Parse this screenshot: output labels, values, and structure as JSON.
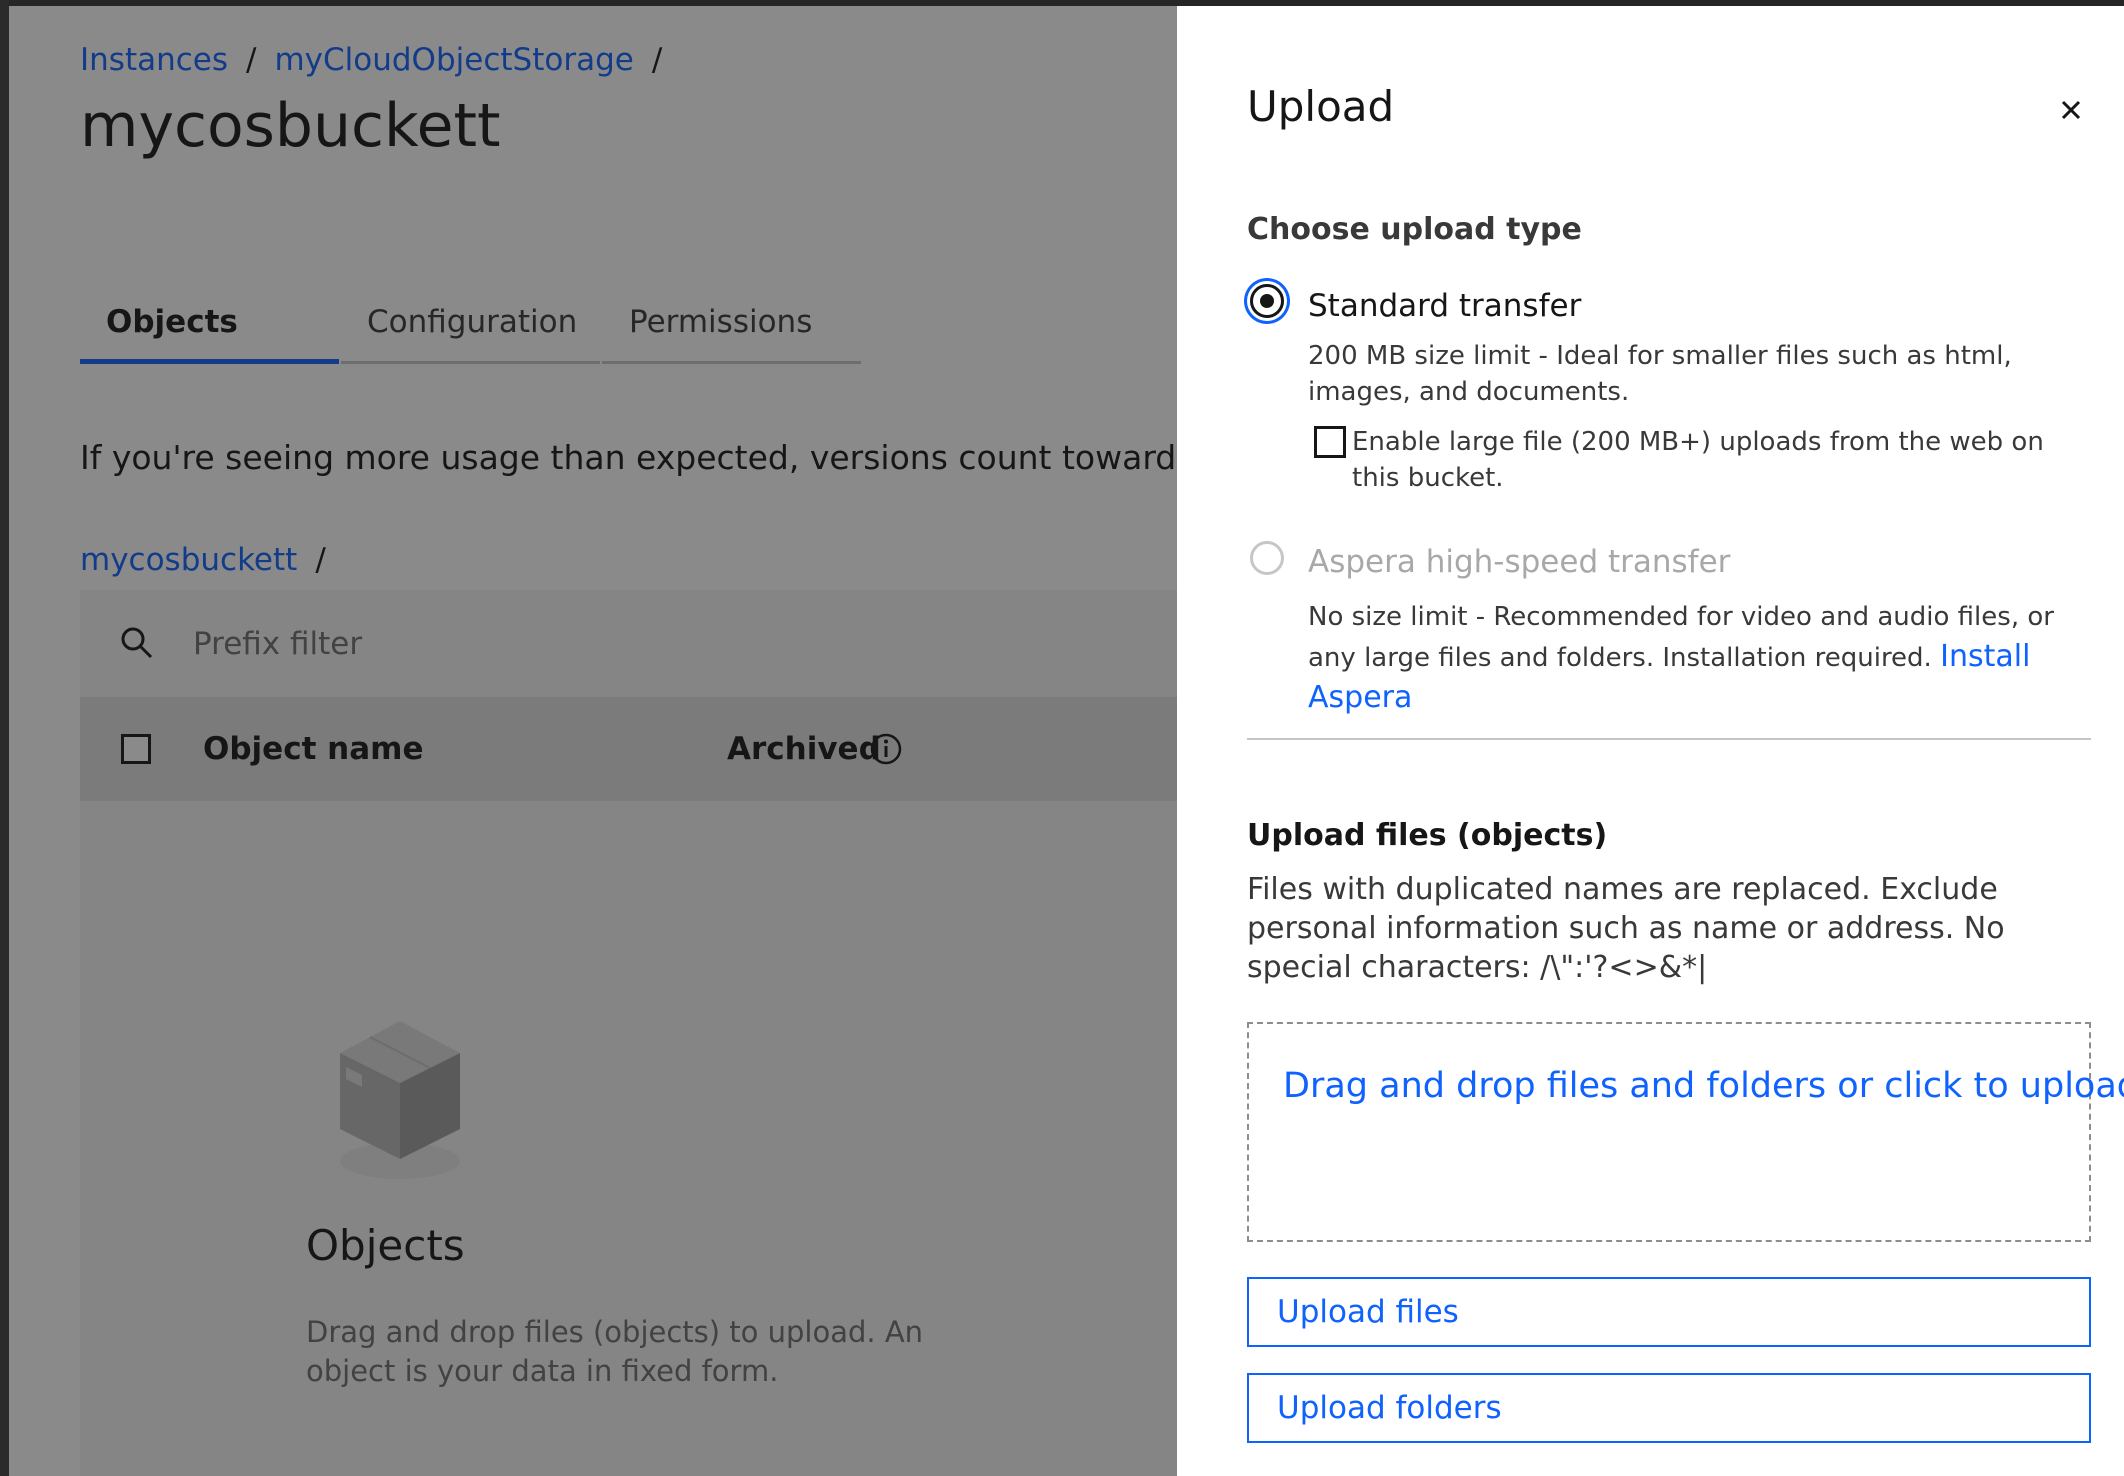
{
  "breadcrumb": {
    "items": [
      "Instances",
      "myCloudObjectStorage"
    ],
    "separator": "/"
  },
  "page_title": "mycosbuckett",
  "tabs": [
    {
      "label": "Objects",
      "active": true
    },
    {
      "label": "Configuration",
      "active": false
    },
    {
      "label": "Permissions",
      "active": false
    }
  ],
  "notice": "If you're seeing more usage than expected, versions count towards yo",
  "sub_breadcrumb": {
    "bucket": "mycosbuckett",
    "separator": "/"
  },
  "search": {
    "placeholder": "Prefix filter",
    "icon": "search-icon"
  },
  "table": {
    "columns": [
      "Object name",
      "Archived"
    ],
    "info_icon": "info-icon"
  },
  "empty_state": {
    "icon": "box-icon",
    "title": "Objects",
    "text": "Drag and drop files (objects) to upload. An object is your data in fixed form."
  },
  "panel": {
    "title": "Upload",
    "close_icon": "close-icon",
    "upload_type_heading": "Choose upload type",
    "standard": {
      "label": "Standard transfer",
      "selected": true,
      "helper": "200 MB size limit - Ideal for smaller files such as html, images, and documents.",
      "large_file_checkbox": {
        "label": "Enable large file (200 MB+) uploads from the web on this bucket.",
        "checked": false
      }
    },
    "aspera": {
      "label": "Aspera high-speed transfer",
      "selected": false,
      "disabled": true,
      "helper": "No size limit - Recommended for video and audio files, or any large files and folders. Installation required.",
      "link": "Install Aspera"
    },
    "upload_files_heading": "Upload files (objects)",
    "upload_description": "Files with duplicated names are replaced. Exclude personal information such as name or address. No special characters: /\\\":'?<>&*|",
    "dropzone_text": "Drag and drop files and folders or click to upload",
    "upload_files_button": "Upload files",
    "upload_folders_button": "Upload folders"
  },
  "colors": {
    "accent": "#0f62fe",
    "text": "#161616",
    "overlay": "rgba(22,22,22,0.5)"
  }
}
